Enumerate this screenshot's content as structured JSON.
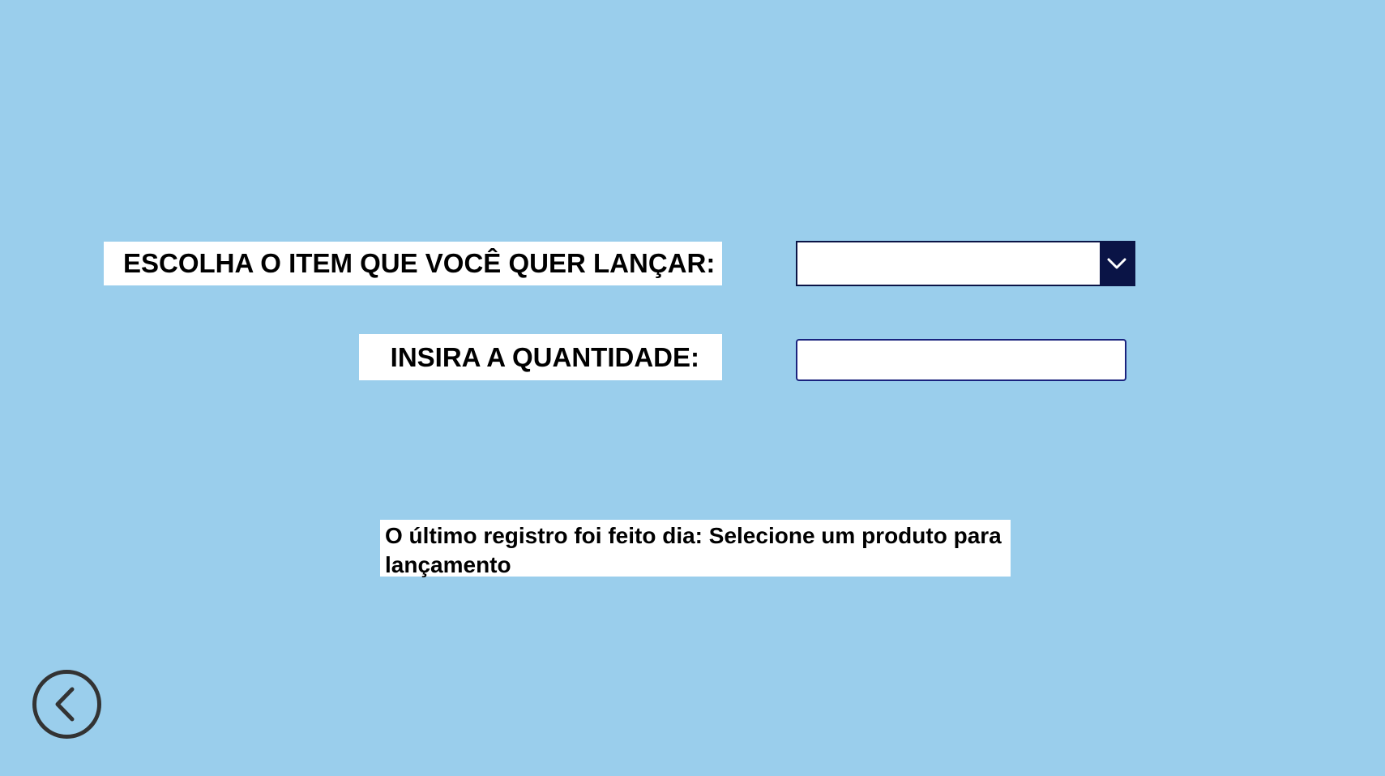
{
  "form": {
    "item_label": "ESCOLHA O ITEM QUE VOCÊ QUER LANÇAR:",
    "item_select_value": "",
    "quantity_label": "INSIRA A QUANTIDADE:",
    "quantity_value": "",
    "quantity_placeholder": ""
  },
  "status": {
    "text": "O último registro foi feito dia: Selecione um produto para lançamento"
  },
  "icons": {
    "dropdown": "chevron-down-icon",
    "back": "back-arrow-icon"
  },
  "colors": {
    "background": "#9ACEEC",
    "label_background": "#FFFFFF",
    "dropdown_button": "#0A1446",
    "input_border": "#1A237E",
    "back_icon": "#333333"
  }
}
